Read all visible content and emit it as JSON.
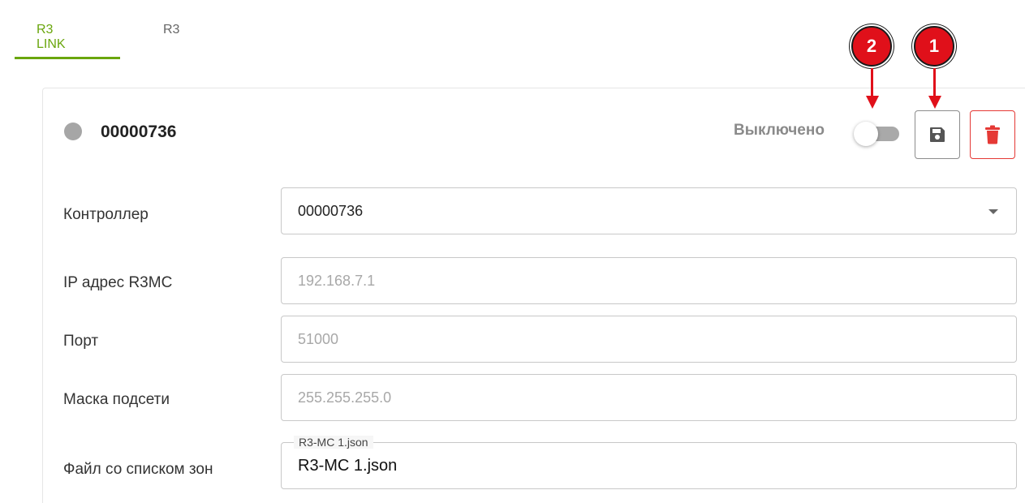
{
  "tabs": [
    {
      "label": "R3 LINK",
      "active": true
    },
    {
      "label": "R3",
      "active": false
    }
  ],
  "card": {
    "status_color": "#a6a6a6",
    "title": "00000736",
    "toggle_label": "Выключено",
    "toggle_on": false,
    "save_icon": "floppy-disk-icon",
    "delete_icon": "trash-icon"
  },
  "callouts": [
    {
      "number": "1",
      "target": "save-button"
    },
    {
      "number": "2",
      "target": "enable-toggle"
    }
  ],
  "form": {
    "controller": {
      "label": "Контроллер",
      "value": "00000736"
    },
    "ip": {
      "label": "IP адрес R3MC",
      "placeholder": "192.168.7.1"
    },
    "port": {
      "label": "Порт",
      "placeholder": "51000"
    },
    "mask": {
      "label": "Маска подсети",
      "placeholder": "255.255.255.0"
    },
    "zones_file": {
      "label": "Файл со списком зон",
      "legend": "R3-MC 1.json",
      "value": "R3-MC 1.json"
    }
  },
  "colors": {
    "accent": "#6aa60d",
    "danger": "#e53935",
    "callout": "#e0101a"
  }
}
